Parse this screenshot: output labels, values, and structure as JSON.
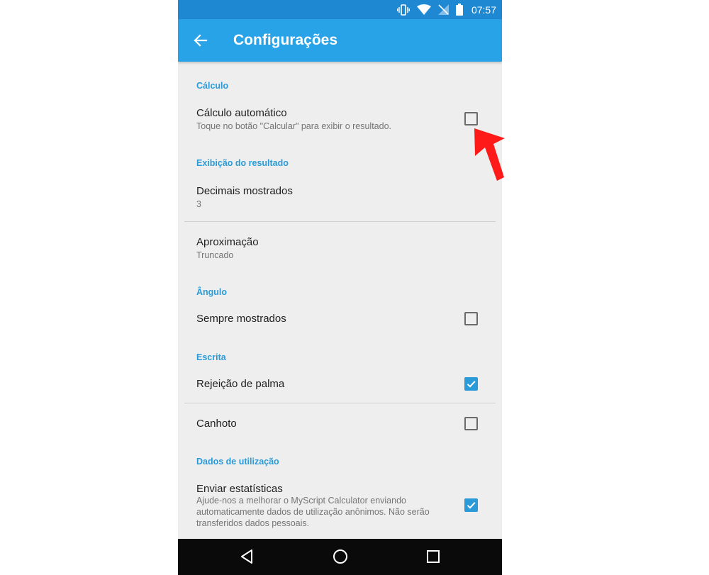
{
  "status_bar": {
    "time": "07:57",
    "icons": [
      "vibrate-icon",
      "wifi-icon",
      "no-signal-icon",
      "battery-icon"
    ]
  },
  "toolbar": {
    "back_icon": "arrow-left-icon",
    "title": "Configurações"
  },
  "sections": {
    "calculo": "Cálculo",
    "exibicao": "Exibição do resultado",
    "angulo": "Ângulo",
    "escrita": "Escrita",
    "dados": "Dados de utilização"
  },
  "settings": {
    "calculo_automatico": {
      "title": "Cálculo automático",
      "subtitle": "Toque no botão \"Calcular\" para exibir o resultado.",
      "checked": false
    },
    "decimais": {
      "title": "Decimais mostrados",
      "value": "3"
    },
    "aproximacao": {
      "title": "Aproximação",
      "value": "Truncado"
    },
    "sempre_mostrados": {
      "title": "Sempre mostrados",
      "checked": false
    },
    "rejeicao_palma": {
      "title": "Rejeição de palma",
      "checked": true
    },
    "canhoto": {
      "title": "Canhoto",
      "checked": false
    },
    "enviar_estatisticas": {
      "title": "Enviar estatísticas",
      "subtitle_lines": [
        "Ajude-nos a melhorar o MyScript Calculator enviando",
        "automaticamente dados de utilização anônimos. Não serão",
        "transferidos dados pessoais."
      ],
      "checked": true
    }
  },
  "nav_bar": {
    "icons": [
      "back-triangle-icon",
      "home-circle-icon",
      "recents-square-icon"
    ]
  },
  "colors": {
    "status_bar": "#1f88d3",
    "toolbar": "#29a3e8",
    "accent": "#2a9bd8",
    "background": "#eeeeee",
    "annotation_arrow": "#ff1a1a"
  }
}
